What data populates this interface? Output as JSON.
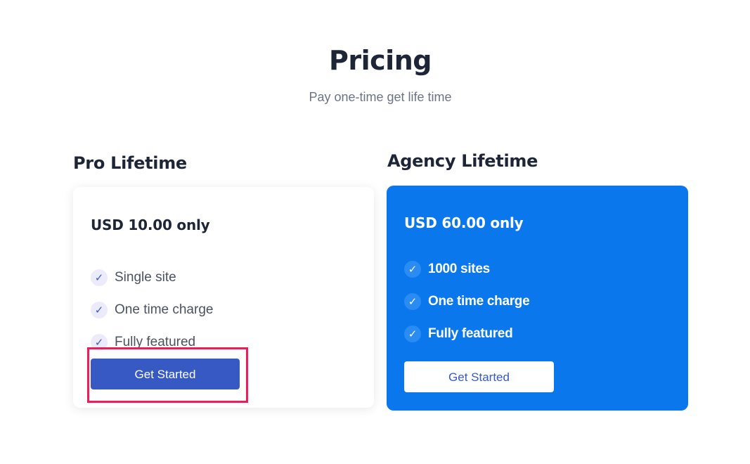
{
  "header": {
    "title": "Pricing",
    "subtitle": "Pay one-time get life time"
  },
  "plans": [
    {
      "name": "Pro Lifetime",
      "price": "USD 10.00 only",
      "features": [
        "Single site",
        "One time charge",
        "Fully featured"
      ],
      "button_label": "Get Started",
      "theme": "light"
    },
    {
      "name": "Agency Lifetime",
      "price": "USD 60.00 only",
      "features": [
        "1000 sites",
        "One time charge",
        "Fully featured"
      ],
      "button_label": "Get Started",
      "theme": "dark"
    }
  ],
  "icons": {
    "feature_check": "check-icon"
  },
  "colors": {
    "accent_blue": "#0a78ec",
    "button_blue": "#3659c4",
    "highlight": "#ea1d5d"
  }
}
